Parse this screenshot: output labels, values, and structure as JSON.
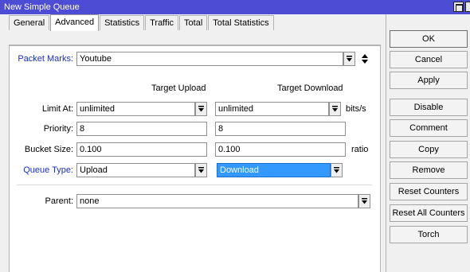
{
  "window": {
    "title": "New Simple Queue"
  },
  "tabs": [
    {
      "label": "General",
      "active": false
    },
    {
      "label": "Advanced",
      "active": true
    },
    {
      "label": "Statistics",
      "active": false
    },
    {
      "label": "Traffic",
      "active": false
    },
    {
      "label": "Total",
      "active": false
    },
    {
      "label": "Total Statistics",
      "active": false
    }
  ],
  "form": {
    "packet_marks": {
      "label": "Packet Marks:",
      "value": "Youtube"
    },
    "col_upload": "Target Upload",
    "col_download": "Target Download",
    "limit_at": {
      "label": "Limit At:",
      "upload": "unlimited",
      "download": "unlimited",
      "unit": "bits/s"
    },
    "priority": {
      "label": "Priority:",
      "upload": "8",
      "download": "8"
    },
    "bucket_size": {
      "label": "Bucket Size:",
      "upload": "0.100",
      "download": "0.100",
      "unit": "ratio"
    },
    "queue_type": {
      "label": "Queue Type:",
      "upload": "Upload",
      "download": "Download"
    },
    "parent": {
      "label": "Parent:",
      "value": "none"
    }
  },
  "buttons": {
    "ok": "OK",
    "cancel": "Cancel",
    "apply": "Apply",
    "disable": "Disable",
    "comment": "Comment",
    "copy": "Copy",
    "remove": "Remove",
    "reset_counters": "Reset Counters",
    "reset_all_counters": "Reset All Counters",
    "torch": "Torch"
  },
  "colors": {
    "titlebar": "#4c4cd4",
    "label_accent": "#1a2fc8",
    "selection": "#3399ff"
  }
}
